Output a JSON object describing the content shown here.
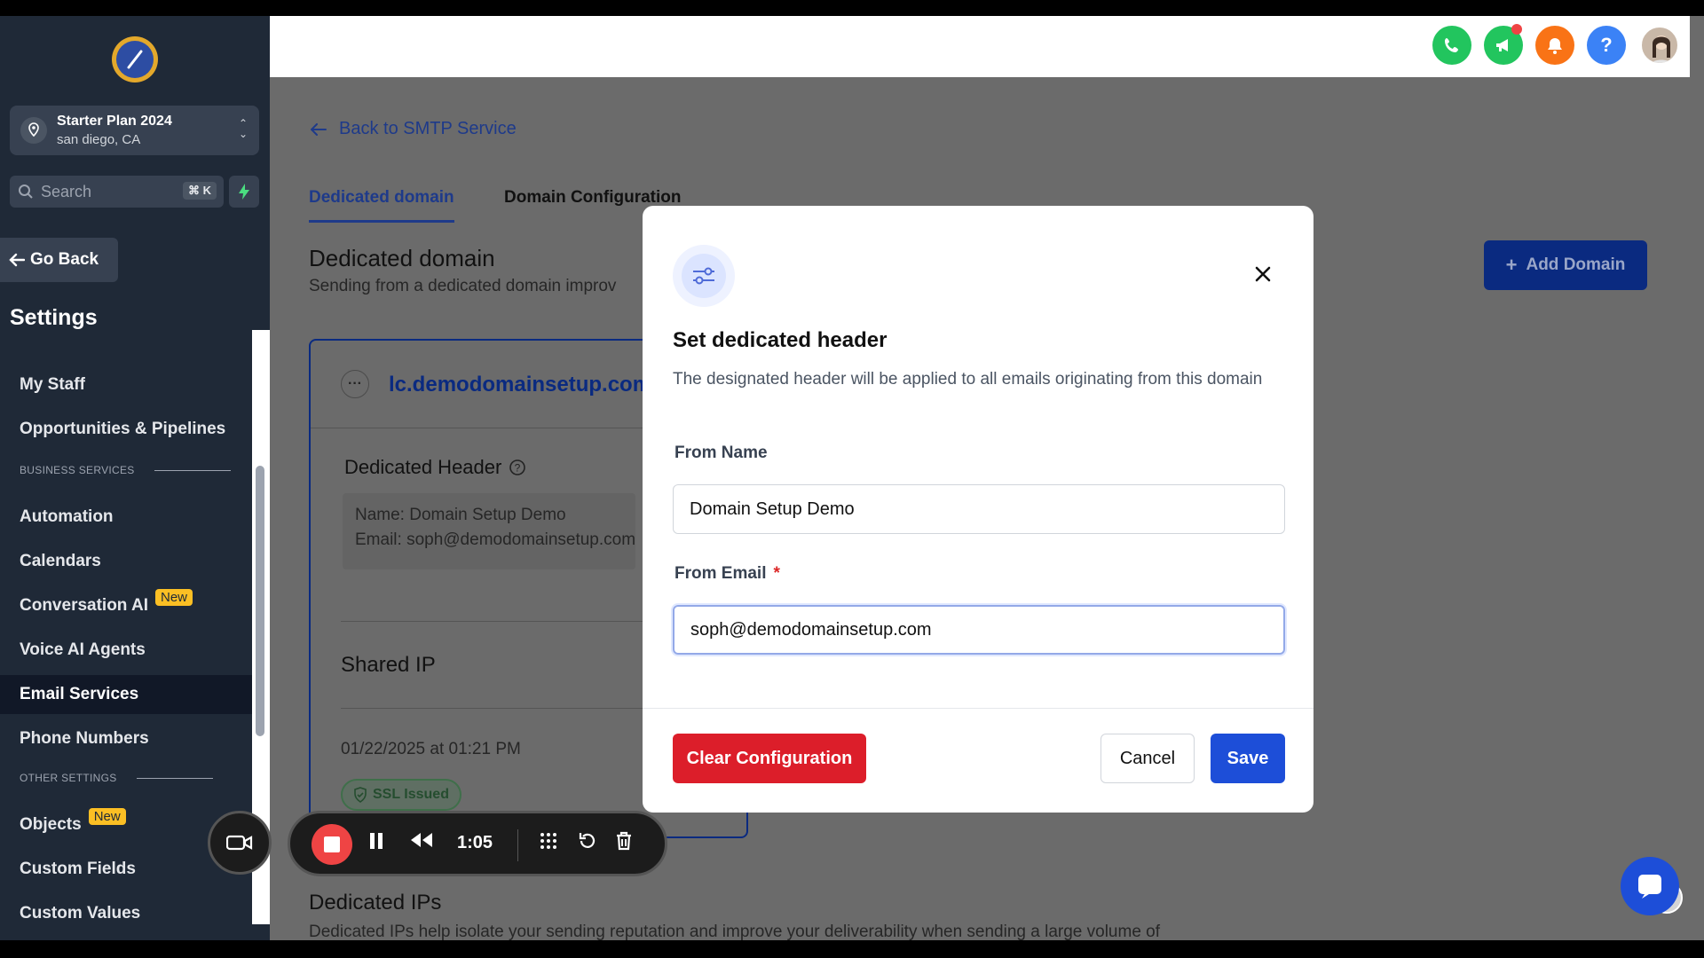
{
  "sidebar": {
    "location": {
      "name": "Starter Plan 2024",
      "sub": "san diego, CA"
    },
    "search": {
      "placeholder": "Search",
      "shortcut": "⌘ K"
    },
    "go_back": "Go Back",
    "settings_title": "Settings",
    "items": [
      {
        "label": "My Staff"
      },
      {
        "label": "Opportunities & Pipelines"
      },
      {
        "label": "Automation"
      },
      {
        "label": "Calendars"
      },
      {
        "label": "Conversation AI",
        "badge": "New"
      },
      {
        "label": "Voice AI Agents"
      },
      {
        "label": "Email Services",
        "active": true
      },
      {
        "label": "Phone Numbers"
      },
      {
        "label": "Objects",
        "badge": "New"
      },
      {
        "label": "Custom Fields"
      },
      {
        "label": "Custom Values"
      }
    ],
    "sections": {
      "business": "BUSINESS SERVICES",
      "other": "OTHER SETTINGS"
    }
  },
  "header": {
    "icons": [
      "phone-icon",
      "megaphone-icon",
      "bell-icon",
      "help-icon"
    ],
    "help_glyph": "?",
    "colors": {
      "phone": "#22c55e",
      "megaphone": "#22c55e",
      "bell": "#f97316",
      "help": "#3b82f6"
    }
  },
  "main": {
    "back_link": "Back to SMTP Service",
    "tabs": [
      {
        "label": "Dedicated domain",
        "active": true
      },
      {
        "label": "Domain Configuration",
        "active": false
      }
    ],
    "title": "Dedicated domain",
    "subtitle": "Sending from a dedicated domain improv",
    "add_domain": "Add Domain",
    "card": {
      "domain": "lc.demodomainsetup.com",
      "header_title": "Dedicated Header",
      "name_line": "Name: Domain Setup Demo",
      "email_line": "Email: soph@demodomainsetup.com",
      "shared_ip": "Shared IP",
      "date": "01/22/2025 at 01:21 PM",
      "ssl": "SSL Issued"
    },
    "dedicated_ips": {
      "title": "Dedicated IPs",
      "subtitle": "Dedicated IPs help isolate your sending reputation and improve your deliverability when sending a large volume of"
    }
  },
  "modal": {
    "title": "Set dedicated header",
    "description": "The designated header will be applied to all emails originating from this domain",
    "from_name_label": "From Name",
    "from_name_value": "Domain Setup Demo",
    "from_email_label": "From Email",
    "required_mark": "*",
    "from_email_value": "soph@demodomainsetup.com",
    "clear_button": "Clear Configuration",
    "cancel_button": "Cancel",
    "save_button": "Save"
  },
  "recorder": {
    "time": "1:05"
  }
}
